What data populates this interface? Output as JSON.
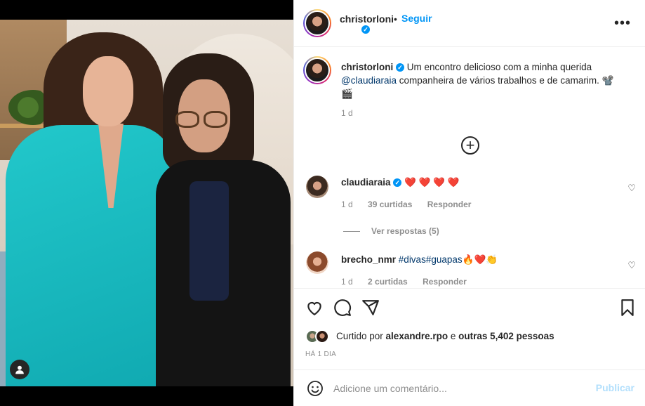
{
  "post": {
    "username": "christorloni",
    "separator": "•",
    "follow_label": "Seguir",
    "more_label": "•••"
  },
  "caption": {
    "username": "christorloni",
    "text_before": " Um encontro delicioso com a minha querida ",
    "mention": "@claudiaraia",
    "text_after": " companheira de vários trabalhos e de camarim. 📽️ 🎬",
    "time": "1 d"
  },
  "comments": [
    {
      "username": "claudiaraia",
      "verified": true,
      "text": "❤️ ❤️ ❤️ ❤️",
      "time": "1 d",
      "likes": "39 curtidas",
      "reply_label": "Responder"
    },
    {
      "username": "brecho_nmr",
      "verified": false,
      "hashtag1": "#divas",
      "hashtag2": "#guapas",
      "text": "🔥❤️👏",
      "time": "1 d",
      "likes": "2 curtidas",
      "reply_label": "Responder"
    }
  ],
  "view_replies_label": "Ver respostas (5)",
  "likes": {
    "prefix": "Curtido por ",
    "user": "alexandre.rpo",
    "middle": " e ",
    "others": "outras 5,402 pessoas"
  },
  "posted_ago": "HÁ 1 DIA",
  "comment_box": {
    "placeholder": "Adicione um comentário...",
    "publish_label": "Publicar"
  },
  "icons": {
    "like": "heart-icon",
    "comment": "comment-icon",
    "share": "paper-plane-icon",
    "save": "bookmark-icon",
    "emoji": "emoji-icon",
    "more": "more-options-icon",
    "load_more": "plus-circle-icon",
    "tag": "user-tag-icon"
  },
  "colors": {
    "link_blue": "#0095f6",
    "mention": "#00376b",
    "muted": "#8e8e8e",
    "publish_disabled": "#b2dffc"
  }
}
